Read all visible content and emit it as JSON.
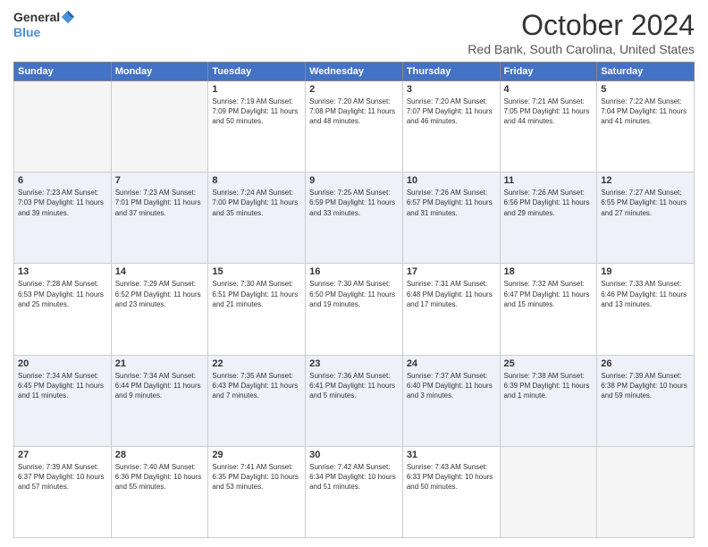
{
  "logo": {
    "general": "General",
    "blue": "Blue"
  },
  "title": "October 2024",
  "location": "Red Bank, South Carolina, United States",
  "days_of_week": [
    "Sunday",
    "Monday",
    "Tuesday",
    "Wednesday",
    "Thursday",
    "Friday",
    "Saturday"
  ],
  "weeks": [
    [
      {
        "day": "",
        "info": ""
      },
      {
        "day": "",
        "info": ""
      },
      {
        "day": "1",
        "info": "Sunrise: 7:19 AM\nSunset: 7:09 PM\nDaylight: 11 hours and 50 minutes."
      },
      {
        "day": "2",
        "info": "Sunrise: 7:20 AM\nSunset: 7:08 PM\nDaylight: 11 hours and 48 minutes."
      },
      {
        "day": "3",
        "info": "Sunrise: 7:20 AM\nSunset: 7:07 PM\nDaylight: 11 hours and 46 minutes."
      },
      {
        "day": "4",
        "info": "Sunrise: 7:21 AM\nSunset: 7:05 PM\nDaylight: 11 hours and 44 minutes."
      },
      {
        "day": "5",
        "info": "Sunrise: 7:22 AM\nSunset: 7:04 PM\nDaylight: 11 hours and 41 minutes."
      }
    ],
    [
      {
        "day": "6",
        "info": "Sunrise: 7:23 AM\nSunset: 7:03 PM\nDaylight: 11 hours and 39 minutes."
      },
      {
        "day": "7",
        "info": "Sunrise: 7:23 AM\nSunset: 7:01 PM\nDaylight: 11 hours and 37 minutes."
      },
      {
        "day": "8",
        "info": "Sunrise: 7:24 AM\nSunset: 7:00 PM\nDaylight: 11 hours and 35 minutes."
      },
      {
        "day": "9",
        "info": "Sunrise: 7:25 AM\nSunset: 6:59 PM\nDaylight: 11 hours and 33 minutes."
      },
      {
        "day": "10",
        "info": "Sunrise: 7:26 AM\nSunset: 6:57 PM\nDaylight: 11 hours and 31 minutes."
      },
      {
        "day": "11",
        "info": "Sunrise: 7:26 AM\nSunset: 6:56 PM\nDaylight: 11 hours and 29 minutes."
      },
      {
        "day": "12",
        "info": "Sunrise: 7:27 AM\nSunset: 6:55 PM\nDaylight: 11 hours and 27 minutes."
      }
    ],
    [
      {
        "day": "13",
        "info": "Sunrise: 7:28 AM\nSunset: 6:53 PM\nDaylight: 11 hours and 25 minutes."
      },
      {
        "day": "14",
        "info": "Sunrise: 7:29 AM\nSunset: 6:52 PM\nDaylight: 11 hours and 23 minutes."
      },
      {
        "day": "15",
        "info": "Sunrise: 7:30 AM\nSunset: 6:51 PM\nDaylight: 11 hours and 21 minutes."
      },
      {
        "day": "16",
        "info": "Sunrise: 7:30 AM\nSunset: 6:50 PM\nDaylight: 11 hours and 19 minutes."
      },
      {
        "day": "17",
        "info": "Sunrise: 7:31 AM\nSunset: 6:48 PM\nDaylight: 11 hours and 17 minutes."
      },
      {
        "day": "18",
        "info": "Sunrise: 7:32 AM\nSunset: 6:47 PM\nDaylight: 11 hours and 15 minutes."
      },
      {
        "day": "19",
        "info": "Sunrise: 7:33 AM\nSunset: 6:46 PM\nDaylight: 11 hours and 13 minutes."
      }
    ],
    [
      {
        "day": "20",
        "info": "Sunrise: 7:34 AM\nSunset: 6:45 PM\nDaylight: 11 hours and 11 minutes."
      },
      {
        "day": "21",
        "info": "Sunrise: 7:34 AM\nSunset: 6:44 PM\nDaylight: 11 hours and 9 minutes."
      },
      {
        "day": "22",
        "info": "Sunrise: 7:35 AM\nSunset: 6:43 PM\nDaylight: 11 hours and 7 minutes."
      },
      {
        "day": "23",
        "info": "Sunrise: 7:36 AM\nSunset: 6:41 PM\nDaylight: 11 hours and 5 minutes."
      },
      {
        "day": "24",
        "info": "Sunrise: 7:37 AM\nSunset: 6:40 PM\nDaylight: 11 hours and 3 minutes."
      },
      {
        "day": "25",
        "info": "Sunrise: 7:38 AM\nSunset: 6:39 PM\nDaylight: 11 hours and 1 minute."
      },
      {
        "day": "26",
        "info": "Sunrise: 7:39 AM\nSunset: 6:38 PM\nDaylight: 10 hours and 59 minutes."
      }
    ],
    [
      {
        "day": "27",
        "info": "Sunrise: 7:39 AM\nSunset: 6:37 PM\nDaylight: 10 hours and 57 minutes."
      },
      {
        "day": "28",
        "info": "Sunrise: 7:40 AM\nSunset: 6:36 PM\nDaylight: 10 hours and 55 minutes."
      },
      {
        "day": "29",
        "info": "Sunrise: 7:41 AM\nSunset: 6:35 PM\nDaylight: 10 hours and 53 minutes."
      },
      {
        "day": "30",
        "info": "Sunrise: 7:42 AM\nSunset: 6:34 PM\nDaylight: 10 hours and 51 minutes."
      },
      {
        "day": "31",
        "info": "Sunrise: 7:43 AM\nSunset: 6:33 PM\nDaylight: 10 hours and 50 minutes."
      },
      {
        "day": "",
        "info": ""
      },
      {
        "day": "",
        "info": ""
      }
    ]
  ]
}
